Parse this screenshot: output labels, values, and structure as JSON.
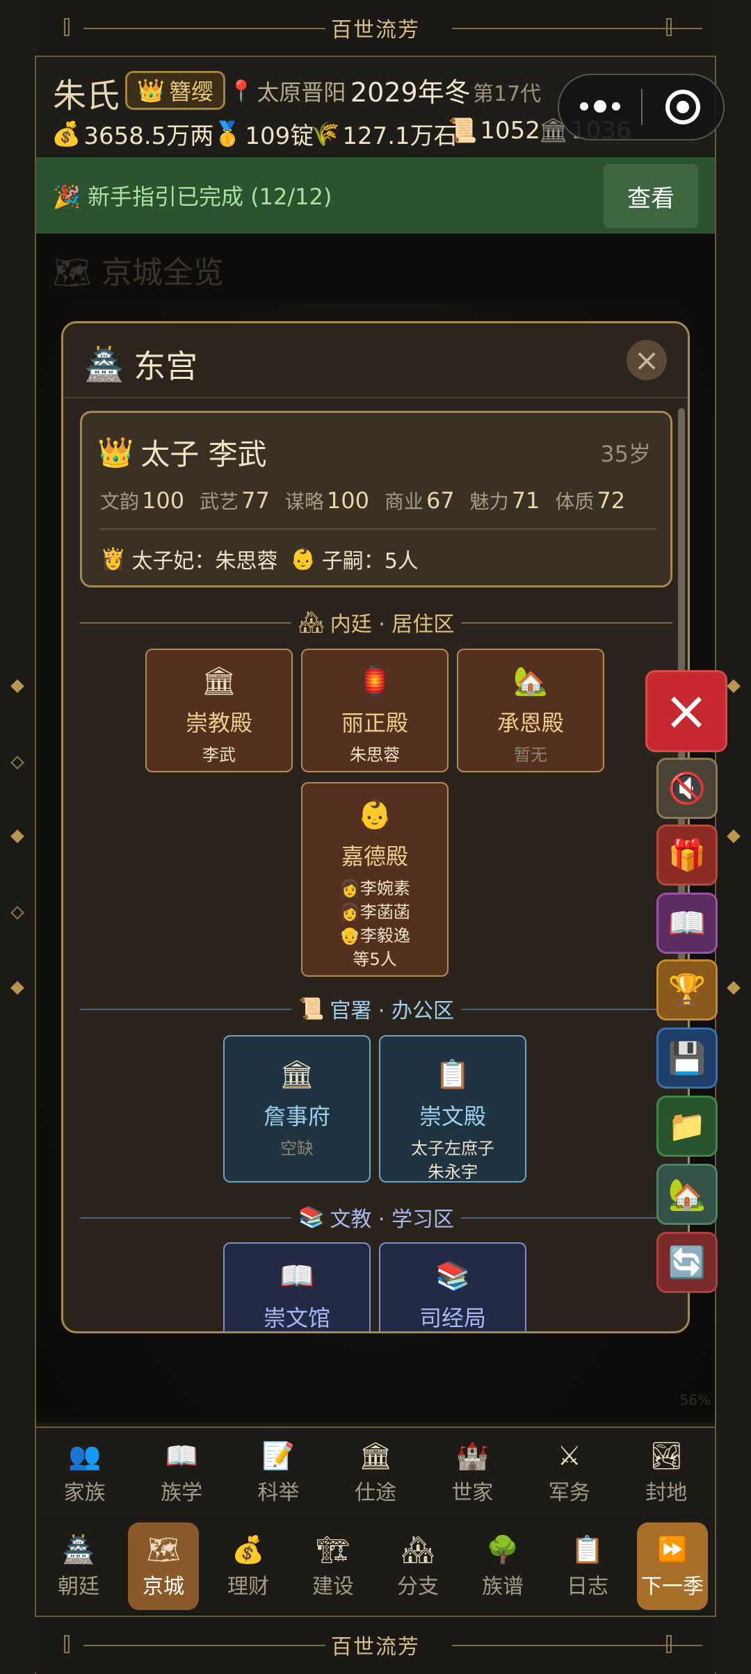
{
  "banner": {
    "top_text": "百世流芳",
    "bottom_text": "百世流芳"
  },
  "header": {
    "surname": "朱氏",
    "rank": "簪缨",
    "location": "太原晋阳",
    "year": "2029年冬",
    "generation": "第17代",
    "resources": [
      {
        "icon": "money-bag-icon",
        "glyph": "💰",
        "value": "3658.5万两"
      },
      {
        "icon": "gold-medal-icon",
        "glyph": "🥇",
        "value": "109锭"
      },
      {
        "icon": "grain-icon",
        "glyph": "🌾",
        "value": "127.1万石"
      },
      {
        "icon": "scroll-icon",
        "glyph": "📜",
        "value": "1052"
      },
      {
        "icon": "temple-icon",
        "glyph": "🏛",
        "value": "1036"
      }
    ]
  },
  "tutorial": {
    "text": "🎉 新手指引已完成 (12/12)",
    "button": "查看"
  },
  "background_page": {
    "title": "京城全览",
    "zoom": "56%"
  },
  "modal": {
    "title": "东宫",
    "prince": {
      "title_name": "太子 李武",
      "age": "35岁",
      "stats": [
        {
          "label": "文韵",
          "value": "100"
        },
        {
          "label": "武艺",
          "value": "77"
        },
        {
          "label": "谋略",
          "value": "100"
        },
        {
          "label": "商业",
          "value": "67"
        },
        {
          "label": "魅力",
          "value": "71"
        },
        {
          "label": "体质",
          "value": "72"
        }
      ],
      "consort_label": "太子妃：朱思蓉",
      "children_label": "子嗣：5人"
    },
    "sections": {
      "inner": {
        "label": "内廷 · 居住区"
      },
      "office": {
        "label": "官署 · 办公区"
      },
      "study": {
        "label": "文教 · 学习区"
      }
    },
    "inner_halls": [
      {
        "name": "崇教殿",
        "sub": "李武",
        "glyph": "🏛"
      },
      {
        "name": "丽正殿",
        "sub": "朱思蓉",
        "glyph": "🏮"
      },
      {
        "name": "承恩殿",
        "sub": "暂无",
        "glyph": "🏡"
      }
    ],
    "jiade": {
      "name": "嘉德殿",
      "glyph": "👶",
      "residents": [
        "👩李婉素",
        "👩李菡菡",
        "👴李毅逸"
      ],
      "more": "等5人"
    },
    "offices": [
      {
        "name": "詹事府",
        "sub": "空缺",
        "glyph": "🏛"
      },
      {
        "name": "崇文殿",
        "sub1": "太子左庶子",
        "sub2": "朱永宇",
        "glyph": "📋"
      }
    ],
    "studies": [
      {
        "name": "崇文馆",
        "glyph": "📖"
      },
      {
        "name": "司经局",
        "glyph": "📚"
      }
    ]
  },
  "nav_top": [
    {
      "label": "家族",
      "glyph": "👥"
    },
    {
      "label": "族学",
      "glyph": "📖"
    },
    {
      "label": "科举",
      "glyph": "📝"
    },
    {
      "label": "仕途",
      "glyph": "🏛"
    },
    {
      "label": "世家",
      "glyph": "🏰"
    },
    {
      "label": "军务",
      "glyph": "⚔"
    },
    {
      "label": "封地",
      "glyph": "🏞"
    }
  ],
  "nav_bottom": [
    {
      "label": "朝廷",
      "glyph": "🏯"
    },
    {
      "label": "京城",
      "glyph": "🗺"
    },
    {
      "label": "理财",
      "glyph": "💰"
    },
    {
      "label": "建设",
      "glyph": "🏗"
    },
    {
      "label": "分支",
      "glyph": "🏘"
    },
    {
      "label": "族谱",
      "glyph": "🌳"
    },
    {
      "label": "日志",
      "glyph": "📋"
    },
    {
      "label": "下一季",
      "glyph": "⏩"
    }
  ],
  "colors": {
    "accent_gold": "#a88a4c",
    "tutorial_green": "#2c5230",
    "close_red": "#c8282f",
    "active_tab": "#8b5a2b"
  }
}
